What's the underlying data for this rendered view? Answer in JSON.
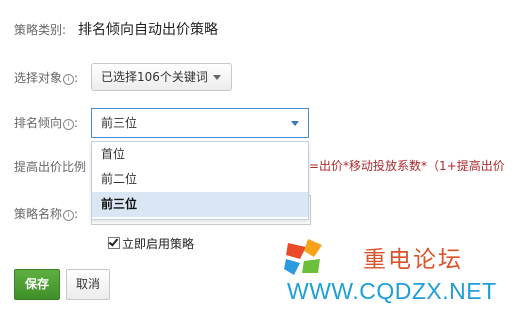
{
  "form": {
    "strategy_type_label": "策略类别:",
    "strategy_type_value": "排名倾向自动出价策略",
    "target_label": "选择对象",
    "target_value": "已选择106个关键词",
    "rank_label": "排名倾向",
    "rank_value": "前三位",
    "rank_options": [
      "首位",
      "前二位",
      "前三位"
    ],
    "rank_selected_index": 2,
    "increase_label": "提高出价比例",
    "formula_text": "=出价*移动投放系数*（1+提高出价",
    "name_label": "策略名称",
    "name_value": "",
    "enable_label": "立即启用策略",
    "enable_checked": true,
    "info_glyph": "i",
    "colon": ":",
    "save_label": "保存",
    "cancel_label": "取消"
  },
  "watermark": {
    "title": "重电论坛",
    "url": "WWW.CQDZX.NET",
    "logo_colors": [
      "#e94b2b",
      "#f7a21b",
      "#2b9be0",
      "#6cbf3a"
    ]
  },
  "colors": {
    "accent_blue": "#4a8bd6",
    "save_green": "#4aa031",
    "formula_red": "#b02a2a",
    "watermark_red": "#d9542c",
    "watermark_blue": "#1d9fd8"
  }
}
